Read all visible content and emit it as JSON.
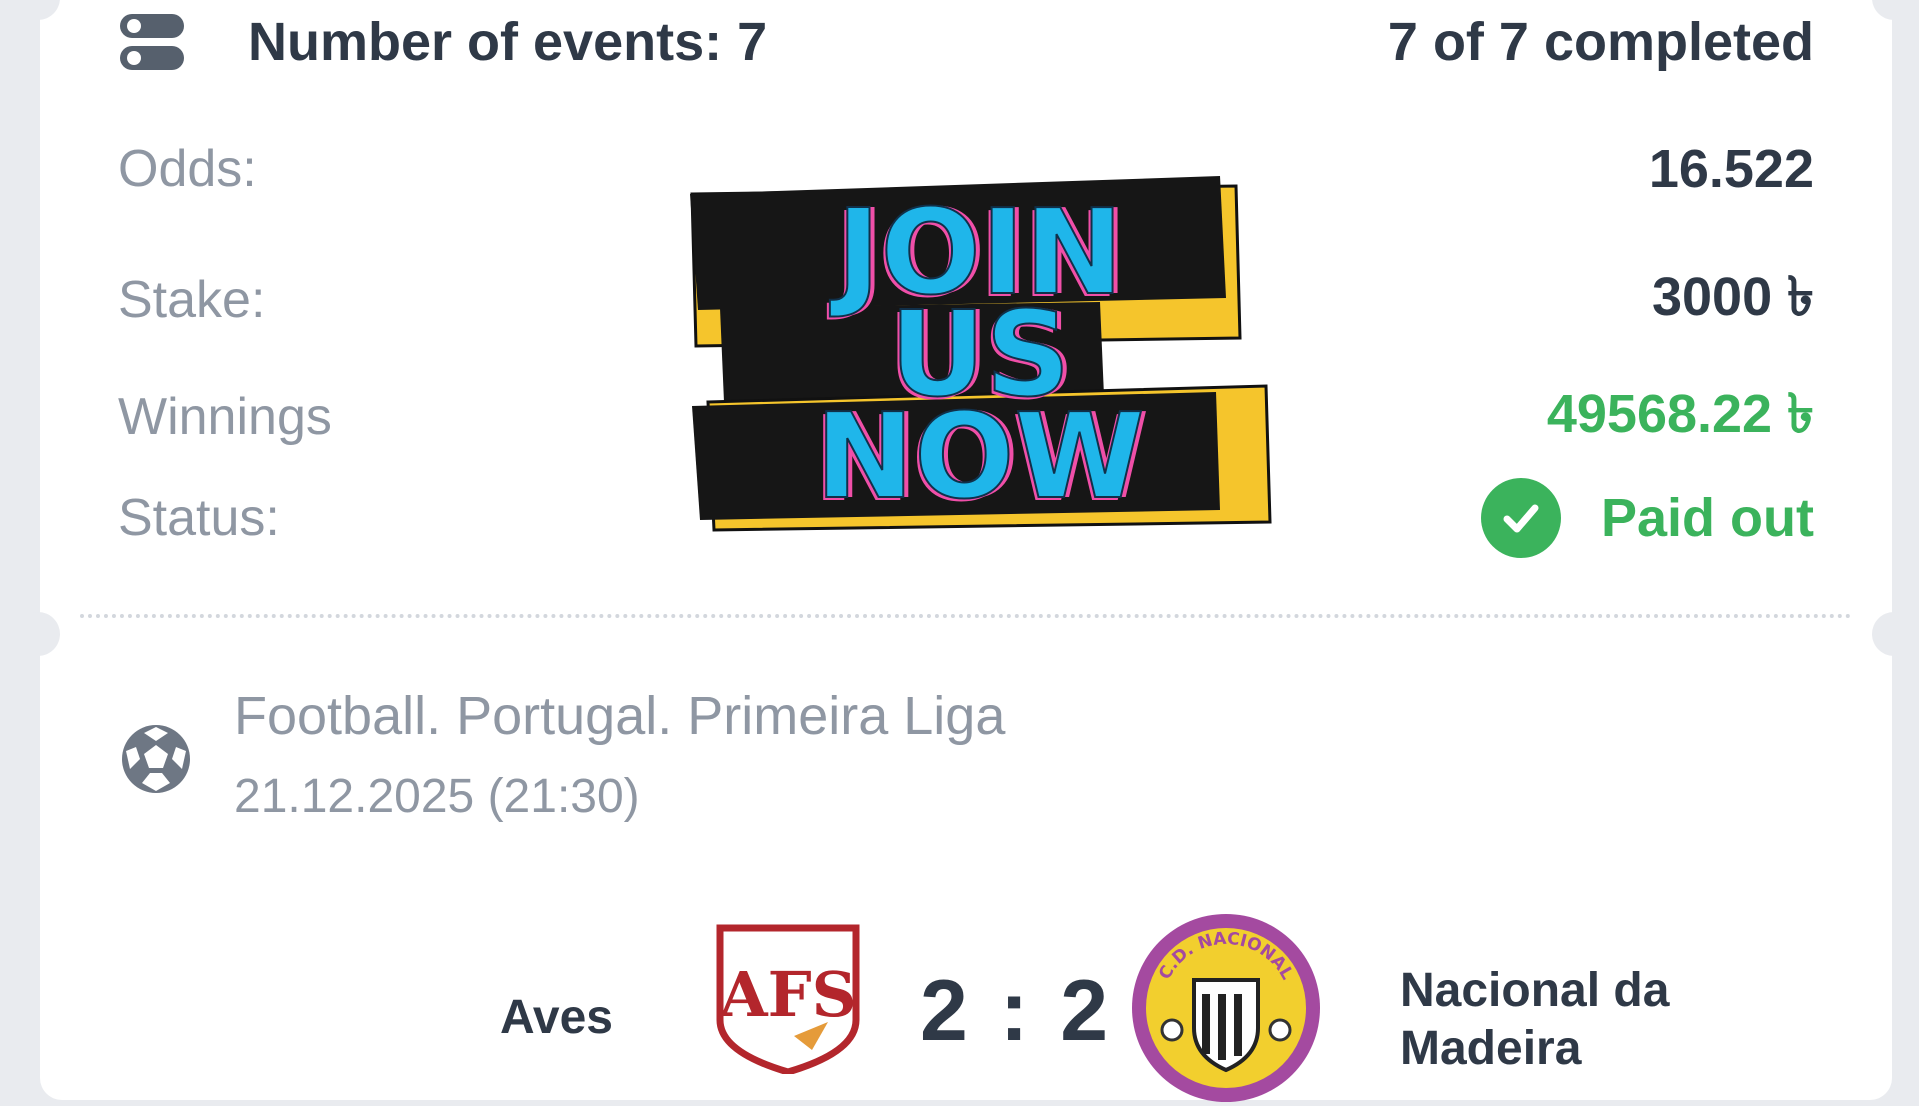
{
  "summary": {
    "events_label": "Number of events: 7",
    "completed": "7 of 7 completed"
  },
  "details": {
    "odds_label": "Odds:",
    "odds_value": "16.522",
    "stake_label": "Stake:",
    "stake_value": "3000 ৳",
    "winnings_label": "Winnings",
    "winnings_value": "49568.22 ৳",
    "status_label": "Status:",
    "status_value": "Paid out"
  },
  "promo": {
    "lines": [
      "JOIN",
      "US",
      "NOW"
    ]
  },
  "event": {
    "league": "Football. Portugal. Primeira Liga",
    "datetime": "21.12.2025 (21:30)",
    "home_team": "Aves",
    "away_team": "Nacional da Madeira",
    "away_team_line1": "Nacional da",
    "away_team_line2": "Madeira",
    "score": "2 : 2",
    "home_logo_text": "AFS",
    "away_logo_text": "C.D. NACIONAL"
  },
  "colors": {
    "accent_green": "#3bb35c",
    "text_dark": "#2f3947",
    "text_muted": "#8f97a3",
    "promo_blue": "#1fb6ea",
    "promo_pink": "#f04fa8",
    "promo_yellow": "#f5c52c"
  },
  "icons": {
    "summary": "list-toggle-icon",
    "status": "check-circle-icon",
    "sport": "football-icon"
  }
}
